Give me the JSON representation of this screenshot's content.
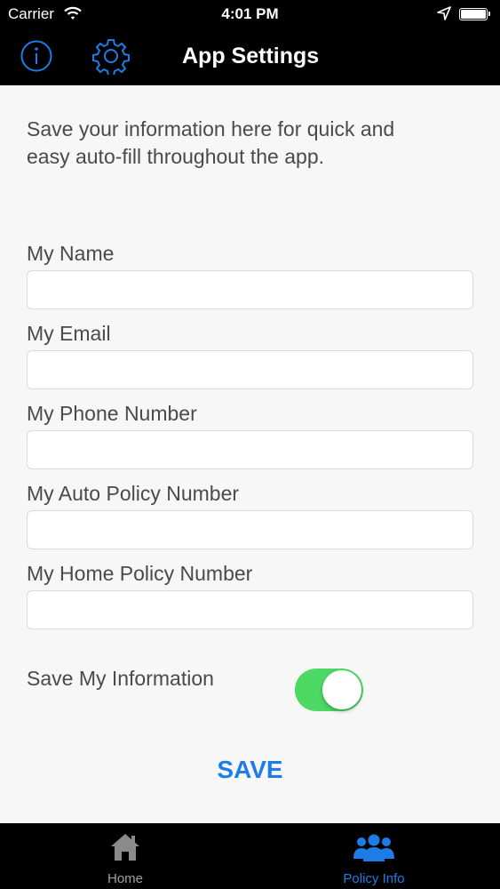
{
  "status_bar": {
    "carrier": "Carrier",
    "time": "4:01 PM"
  },
  "nav": {
    "title": "App Settings",
    "icons": [
      "info-icon",
      "gear-icon"
    ]
  },
  "intro": "Save your information here for quick and easy auto-fill throughout the app.",
  "fields": [
    {
      "label": "My Name",
      "value": "",
      "placeholder": ""
    },
    {
      "label": "My Email",
      "value": "",
      "placeholder": ""
    },
    {
      "label": "My Phone Number",
      "value": "",
      "placeholder": ""
    },
    {
      "label": "My Auto Policy Number",
      "value": "",
      "placeholder": ""
    },
    {
      "label": "My Home Policy Number",
      "value": "",
      "placeholder": ""
    }
  ],
  "toggle": {
    "label": "Save My Information",
    "on": true
  },
  "save_label": "SAVE",
  "tabs": [
    {
      "label": "Home",
      "icon": "home-icon",
      "active": false
    },
    {
      "label": "Policy Info",
      "icon": "people-icon",
      "active": true
    }
  ],
  "colors": {
    "accent": "#1d7de6",
    "toggle_on": "#4cd964",
    "bar_background": "#000000",
    "content_background": "#f7f7f7",
    "text": "#4a4a4a"
  }
}
